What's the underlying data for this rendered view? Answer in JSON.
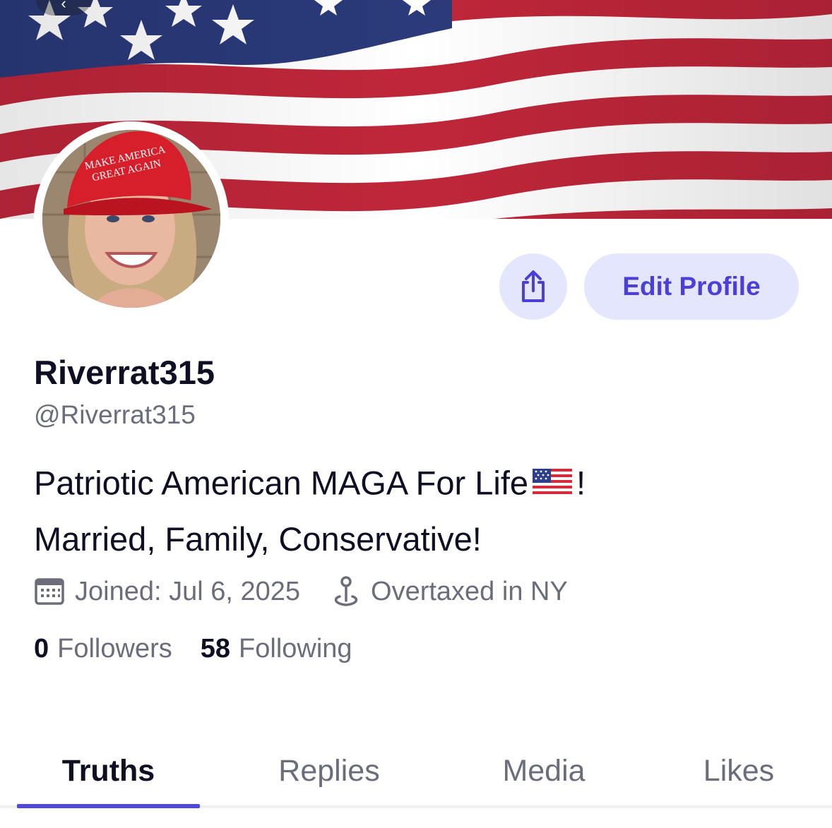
{
  "colors": {
    "accent": "#5148dd",
    "button_bg": "#e4e6fd",
    "button_text": "#4a3fd6",
    "text_primary": "#0f0f23",
    "text_secondary": "#6b6d7b"
  },
  "header": {
    "banner": "american-flag-banner",
    "back_icon": "chevron-left-icon"
  },
  "profile": {
    "avatar": "profile-photo",
    "display_name": "Riverrat315",
    "handle": "@Riverrat315",
    "bio": {
      "line1_before": "Patriotic American MAGA For Life",
      "line1_emoji": "us-flag-emoji",
      "line1_after": "!",
      "line2": "Married, Family, Conservative!"
    },
    "joined": "Joined: Jul 6, 2025",
    "location": "Overtaxed in NY"
  },
  "actions": {
    "share_icon": "share-icon",
    "edit_label": "Edit Profile"
  },
  "stats": {
    "followers_count": "0",
    "followers_label": "Followers",
    "following_count": "58",
    "following_label": "Following"
  },
  "tabs": [
    {
      "label": "Truths",
      "active": true
    },
    {
      "label": "Replies",
      "active": false
    },
    {
      "label": "Media",
      "active": false
    },
    {
      "label": "Likes",
      "active": false
    }
  ]
}
